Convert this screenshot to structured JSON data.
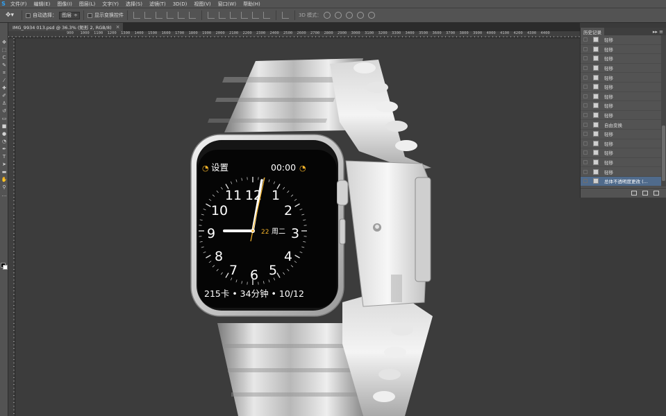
{
  "menubar": {
    "logo": "S",
    "items": [
      "文件(F)",
      "编辑(E)",
      "图像(I)",
      "图层(L)",
      "文字(Y)",
      "选择(S)",
      "滤镜(T)",
      "3D(D)",
      "视图(V)",
      "窗口(W)",
      "帮助(H)"
    ]
  },
  "options": {
    "move_tool_icon": "move-icon",
    "auto_select_label": "自动选择：",
    "auto_select_value": "图层",
    "show_transform_label": "显示变换控件",
    "mode_3d_label": "3D 模式："
  },
  "tab": {
    "title": "IMG_9934 013.psd @ 36.3% (矩形 2, RGB/8)",
    "close": "×"
  },
  "ruler": {
    "labels": [
      "900",
      "1000",
      "1100",
      "1200",
      "1300",
      "1400",
      "1500",
      "1600",
      "1700",
      "1800",
      "1900",
      "2000",
      "2100",
      "2200",
      "2300",
      "2400",
      "2500",
      "2600",
      "2700",
      "2800",
      "2900",
      "3000",
      "3100",
      "3200",
      "3300",
      "3400",
      "3500",
      "3600",
      "3700",
      "3800",
      "3900",
      "4000",
      "4100",
      "4200",
      "4300",
      "4400"
    ]
  },
  "watch": {
    "top_left": "设置",
    "top_right": "00:00",
    "date_number": "22",
    "weekday": "周二",
    "numerals": [
      "12",
      "1",
      "2",
      "3",
      "4",
      "5",
      "6",
      "7",
      "8",
      "9",
      "10",
      "11"
    ],
    "bottom": "215卡 • 34分钟 • 10/12",
    "accent_color": "#f3b22a"
  },
  "history": {
    "title": "历史记录",
    "menu": "▸▸ ≡",
    "items": [
      "轻移",
      "轻移",
      "轻移",
      "轻移",
      "轻移",
      "轻移",
      "轻移",
      "轻移",
      "轻移",
      "自由变换",
      "轻移",
      "轻移",
      "轻移",
      "轻移",
      "轻移",
      "总体不透明度更改 (..."
    ],
    "active_index": 15
  }
}
